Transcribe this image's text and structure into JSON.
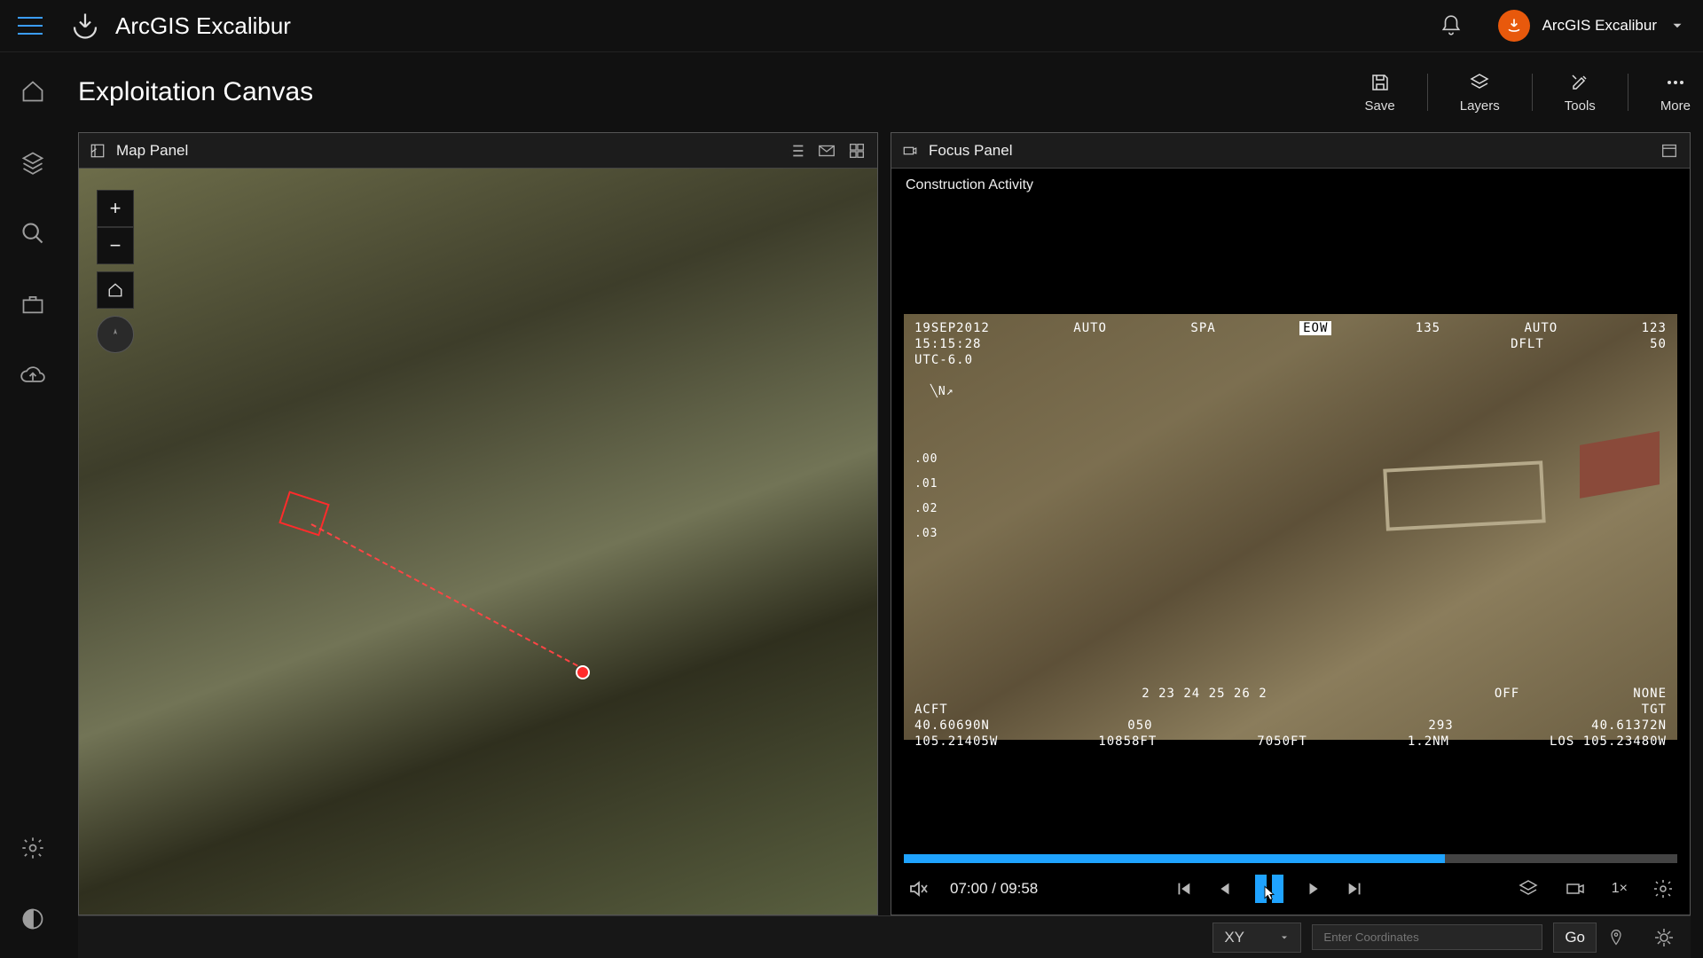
{
  "app": {
    "title": "ArcGIS Excalibur",
    "user": "ArcGIS Excalibur"
  },
  "page": {
    "title": "Exploitation Canvas"
  },
  "headerTools": {
    "save": "Save",
    "layers": "Layers",
    "tools": "Tools",
    "more": "More"
  },
  "mapPanel": {
    "title": "Map Panel"
  },
  "focusPanel": {
    "title": "Focus Panel",
    "subtitle": "Construction Activity",
    "hud": {
      "date": "19SEP2012",
      "auto1": "AUTO",
      "spa": "SPA",
      "eow": "EOW",
      "n135": "135",
      "auto2": "AUTO",
      "n123": "123",
      "time": "15:15:28",
      "dflt": "DFLT",
      "n50": "50",
      "utc": "UTC-6.0",
      "compass": "╲N↗",
      "s00": ".00",
      "s01": ".01",
      "s02": ".02",
      "s03": ".03",
      "bnums": "2  23  24  25  26  2",
      "off": "OFF",
      "none": "NONE",
      "acft": "ACFT",
      "tgt": "TGT",
      "lat1": "40.60690N",
      "n050": "050",
      "n293": "293",
      "lat2": "40.61372N",
      "lon1": "105.21405W",
      "alt1": "10858FT",
      "alt2": "7050FT",
      "rng": "1.2NM",
      "los": "LOS 105.23480W"
    },
    "time": {
      "current": "07:00",
      "sep": " / ",
      "total": "09:58"
    },
    "speed": "1×"
  },
  "bottom": {
    "coordMode": "XY",
    "placeholder": "Enter Coordinates",
    "go": "Go"
  }
}
